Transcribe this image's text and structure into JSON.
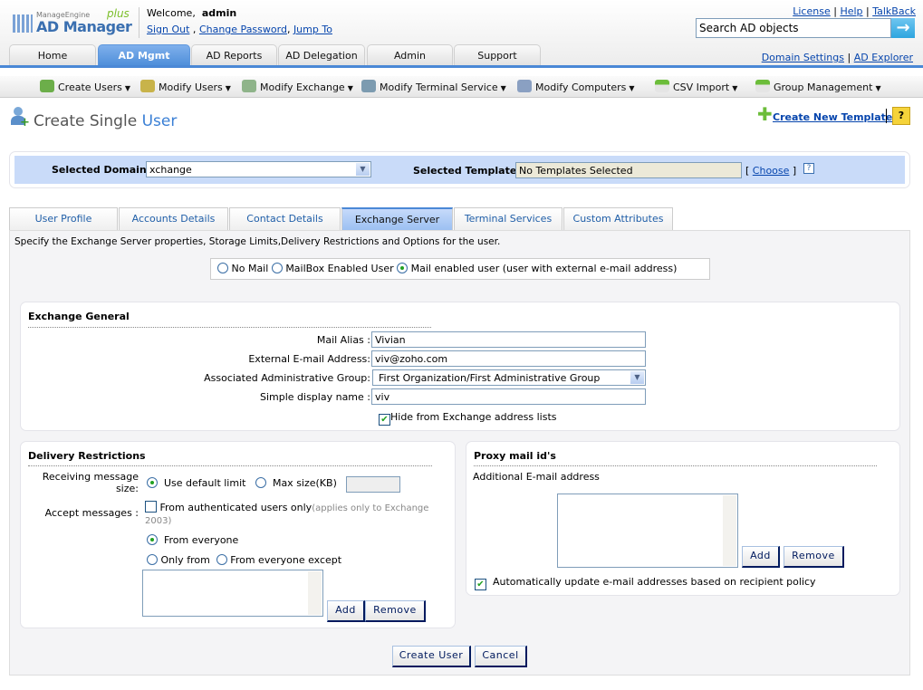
{
  "header": {
    "logo": {
      "brand": "ManageEngine",
      "product": "AD Manager",
      "edition": "plus"
    },
    "welcome": "Welcome,",
    "user": "admin",
    "links": [
      "Sign Out",
      "Change Password",
      "Jump To"
    ],
    "top_links": [
      "License",
      "Help",
      "TalkBack"
    ],
    "search_placeholder": "Search AD objects",
    "right_links": [
      "Domain Settings",
      "AD Explorer"
    ]
  },
  "main_tabs": [
    "Home",
    "AD Mgmt",
    "AD Reports",
    "AD Delegation",
    "Admin",
    "Support"
  ],
  "active_main_tab": "AD Mgmt",
  "sub_menu": [
    "Create Users",
    "Modify Users",
    "Modify Exchange",
    "Modify Terminal Service",
    "Modify Computers",
    "CSV Import",
    "Group Management"
  ],
  "page": {
    "title_a": "Create Single",
    "title_b": "User",
    "create_template": "Create New Template",
    "help_icon": "?"
  },
  "domain_bar": {
    "domain_label": "Selected Domain:",
    "domain_value": "xchange",
    "template_label": "Selected Template:",
    "template_value": "No Templates Selected",
    "choose": "Choose",
    "bracket_open": "[",
    "bracket_close": "]",
    "help": "?"
  },
  "form_tabs": [
    "User Profile",
    "Accounts Details",
    "Contact Details",
    "Exchange Server",
    "Terminal Services",
    "Custom Attributes"
  ],
  "active_form_tab": "Exchange Server",
  "description": "Specify the Exchange Server properties, Storage Limits,Delivery Restrictions and Options for the user.",
  "mail_type": {
    "options": [
      "No Mail",
      "MailBox Enabled User",
      "Mail enabled user (user with external e-mail address)"
    ],
    "selected": "Mail enabled user (user with external e-mail address)"
  },
  "exchange_general": {
    "title": "Exchange General",
    "mail_alias_label": "Mail Alias :",
    "mail_alias": "Vivian",
    "external_email_label": "External E-mail Address:",
    "external_email": "viv@zoho.com",
    "admin_group_label": "Associated Administrative Group:",
    "admin_group": "First Organization/First Administrative Group",
    "display_name_label": "Simple display name :",
    "display_name": "viv",
    "hide_label": "Hide from Exchange address lists",
    "hide_checked": true
  },
  "delivery": {
    "title": "Delivery Restrictions",
    "receiving_label": "Receiving message size:",
    "use_default": "Use default limit",
    "max_size": "Max size(KB)",
    "max_size_value": "",
    "accept_label": "Accept messages :",
    "auth_only": "From authenticated users only",
    "auth_note": "(applies only to Exchange 2003)",
    "auth_checked": false,
    "from_everyone": "From everyone",
    "only_from": "Only from",
    "everyone_except": "From everyone except",
    "add": "Add",
    "remove": "Remove"
  },
  "proxy": {
    "title": "Proxy mail id's",
    "additional_label": "Additional E-mail address",
    "add": "Add",
    "remove": "Remove",
    "auto_update": "Automatically update e-mail addresses based on recipient policy",
    "auto_checked": true
  },
  "actions": {
    "create": "Create User",
    "cancel": "Cancel"
  }
}
